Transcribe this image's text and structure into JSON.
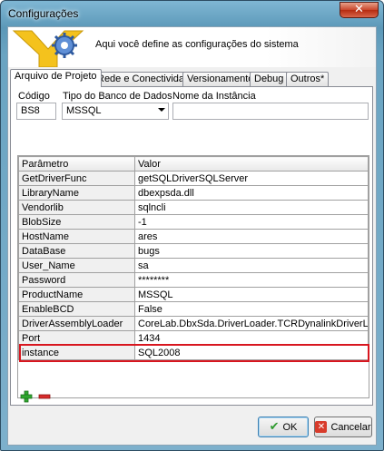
{
  "window": {
    "title": "Configurações"
  },
  "header": {
    "description": "Aqui você define as configurações do sistema"
  },
  "tabs": [
    {
      "label": "Arquivo de Projeto",
      "active": true
    },
    {
      "label": "Rede e Conectividade"
    },
    {
      "label": "Versionamento"
    },
    {
      "label": "Debug"
    },
    {
      "label": "Outros*"
    }
  ],
  "form": {
    "codigo_label": "Código",
    "codigo_value": "BS8",
    "tipo_label": "Tipo do Banco de Dados",
    "tipo_value": "MSSQL",
    "nome_label": "Nome da Instância",
    "nome_value": ""
  },
  "grid": {
    "headers": [
      "Parâmetro",
      "Valor"
    ],
    "rows": [
      [
        "GetDriverFunc",
        "getSQLDriverSQLServer"
      ],
      [
        "LibraryName",
        "dbexpsda.dll"
      ],
      [
        "Vendorlib",
        "sqlncli"
      ],
      [
        "BlobSize",
        "-1"
      ],
      [
        "HostName",
        "ares"
      ],
      [
        "DataBase",
        "bugs"
      ],
      [
        "User_Name",
        "sa"
      ],
      [
        "Password",
        "********"
      ],
      [
        "ProductName",
        "MSSQL"
      ],
      [
        "EnableBCD",
        "False"
      ],
      [
        "DriverAssemblyLoader",
        "CoreLab.DbxSda.DriverLoader.TCRDynalinkDriverLoader,CoreL"
      ],
      [
        "Port",
        "1434"
      ],
      [
        "instance",
        "SQL2008"
      ]
    ]
  },
  "buttons": {
    "ok": "OK",
    "cancel": "Cancelar"
  },
  "colors": {
    "highlight": "#d8161f",
    "add": "#2fa82f",
    "remove": "#d82c2c"
  }
}
